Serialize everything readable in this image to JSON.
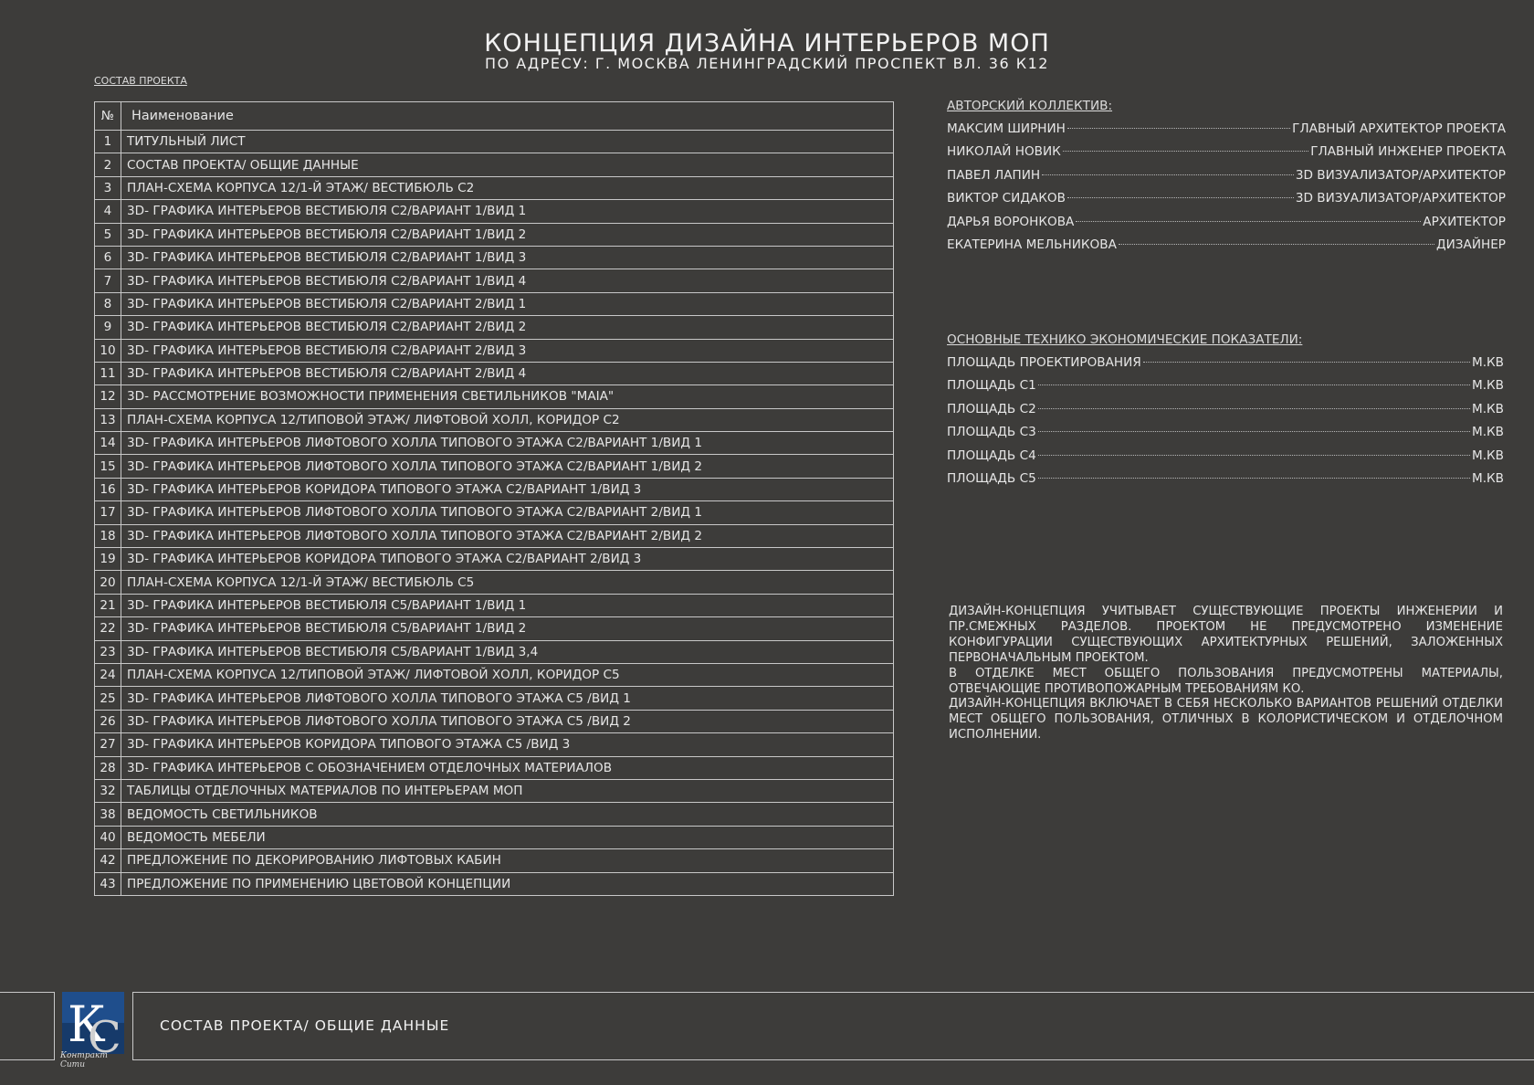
{
  "header": {
    "title": "КОНЦЕПЦИЯ ДИЗАЙНА ИНТЕРЬЕРОВ МОП",
    "subtitle": "ПО АДРЕСУ: Г. МОСКВА ЛЕНИНГРАДСКИЙ ПРОСПЕКТ ВЛ. 36 К12",
    "section_link": "СОСТАВ ПРОЕКТА"
  },
  "contents": {
    "col_num": "№",
    "col_name": "Наименование",
    "rows": [
      {
        "num": "1",
        "name": "ТИТУЛЬНЫЙ ЛИСТ"
      },
      {
        "num": "2",
        "name": "СОСТАВ ПРОЕКТА/ ОБЩИЕ ДАННЫЕ"
      },
      {
        "num": "3",
        "name": "ПЛАН-СХЕМА КОРПУСА 12/1-Й ЭТАЖ/ ВЕСТИБЮЛЬ С2"
      },
      {
        "num": "4",
        "name": "3D- ГРАФИКА ИНТЕРЬЕРОВ ВЕСТИБЮЛЯ С2/ВАРИАНТ 1/ВИД 1"
      },
      {
        "num": "5",
        "name": "3D- ГРАФИКА ИНТЕРЬЕРОВ ВЕСТИБЮЛЯ С2/ВАРИАНТ 1/ВИД 2"
      },
      {
        "num": "6",
        "name": "3D- ГРАФИКА ИНТЕРЬЕРОВ ВЕСТИБЮЛЯ С2/ВАРИАНТ 1/ВИД 3"
      },
      {
        "num": "7",
        "name": "3D- ГРАФИКА ИНТЕРЬЕРОВ ВЕСТИБЮЛЯ С2/ВАРИАНТ 1/ВИД 4"
      },
      {
        "num": "8",
        "name": "3D- ГРАФИКА ИНТЕРЬЕРОВ ВЕСТИБЮЛЯ С2/ВАРИАНТ 2/ВИД 1"
      },
      {
        "num": "9",
        "name": "3D- ГРАФИКА ИНТЕРЬЕРОВ ВЕСТИБЮЛЯ С2/ВАРИАНТ 2/ВИД 2"
      },
      {
        "num": "10",
        "name": "3D- ГРАФИКА ИНТЕРЬЕРОВ ВЕСТИБЮЛЯ С2/ВАРИАНТ 2/ВИД 3"
      },
      {
        "num": "11",
        "name": "3D- ГРАФИКА ИНТЕРЬЕРОВ ВЕСТИБЮЛЯ С2/ВАРИАНТ 2/ВИД 4"
      },
      {
        "num": "12",
        "name": "3D- РАССМОТРЕНИЕ ВОЗМОЖНОСТИ ПРИМЕНЕНИЯ СВЕТИЛЬНИКОВ \"MAIA\""
      },
      {
        "num": "13",
        "name": "ПЛАН-СХЕМА КОРПУСА 12/ТИПОВОЙ ЭТАЖ/ ЛИФТОВОЙ ХОЛЛ, КОРИДОР С2"
      },
      {
        "num": "14",
        "name": "3D- ГРАФИКА ИНТЕРЬЕРОВ ЛИФТОВОГО ХОЛЛА ТИПОВОГО ЭТАЖА С2/ВАРИАНТ 1/ВИД 1"
      },
      {
        "num": "15",
        "name": "3D- ГРАФИКА ИНТЕРЬЕРОВ ЛИФТОВОГО ХОЛЛА ТИПОВОГО ЭТАЖА С2/ВАРИАНТ 1/ВИД 2"
      },
      {
        "num": "16",
        "name": "3D- ГРАФИКА ИНТЕРЬЕРОВ КОРИДОРА ТИПОВОГО ЭТАЖА С2/ВАРИАНТ 1/ВИД 3"
      },
      {
        "num": "17",
        "name": "3D- ГРАФИКА ИНТЕРЬЕРОВ ЛИФТОВОГО ХОЛЛА ТИПОВОГО ЭТАЖА С2/ВАРИАНТ 2/ВИД 1"
      },
      {
        "num": "18",
        "name": "3D- ГРАФИКА ИНТЕРЬЕРОВ ЛИФТОВОГО ХОЛЛА ТИПОВОГО ЭТАЖА С2/ВАРИАНТ 2/ВИД 2"
      },
      {
        "num": "19",
        "name": "3D- ГРАФИКА ИНТЕРЬЕРОВ КОРИДОРА ТИПОВОГО ЭТАЖА С2/ВАРИАНТ 2/ВИД 3"
      },
      {
        "num": "20",
        "name": "ПЛАН-СХЕМА КОРПУСА 12/1-Й ЭТАЖ/ ВЕСТИБЮЛЬ С5"
      },
      {
        "num": "21",
        "name": "3D- ГРАФИКА ИНТЕРЬЕРОВ ВЕСТИБЮЛЯ С5/ВАРИАНТ 1/ВИД 1"
      },
      {
        "num": "22",
        "name": "3D- ГРАФИКА ИНТЕРЬЕРОВ ВЕСТИБЮЛЯ С5/ВАРИАНТ 1/ВИД 2"
      },
      {
        "num": "23",
        "name": "3D- ГРАФИКА ИНТЕРЬЕРОВ ВЕСТИБЮЛЯ С5/ВАРИАНТ 1/ВИД 3,4"
      },
      {
        "num": "24",
        "name": "ПЛАН-СХЕМА КОРПУСА 12/ТИПОВОЙ ЭТАЖ/ ЛИФТОВОЙ ХОЛЛ, КОРИДОР С5"
      },
      {
        "num": "25",
        "name": "3D- ГРАФИКА ИНТЕРЬЕРОВ ЛИФТОВОГО ХОЛЛА ТИПОВОГО ЭТАЖА С5 /ВИД 1"
      },
      {
        "num": "26",
        "name": "3D- ГРАФИКА ИНТЕРЬЕРОВ ЛИФТОВОГО ХОЛЛА ТИПОВОГО ЭТАЖА С5 /ВИД 2"
      },
      {
        "num": "27",
        "name": "3D- ГРАФИКА ИНТЕРЬЕРОВ КОРИДОРА ТИПОВОГО ЭТАЖА С5 /ВИД 3"
      },
      {
        "num": "28",
        "name": "3D- ГРАФИКА ИНТЕРЬЕРОВ С ОБОЗНАЧЕНИЕМ ОТДЕЛОЧНЫХ МАТЕРИАЛОВ"
      },
      {
        "num": "32",
        "name": "ТАБЛИЦЫ ОТДЕЛОЧНЫХ МАТЕРИАЛОВ ПО ИНТЕРЬЕРАМ МОП"
      },
      {
        "num": "38",
        "name": "ВЕДОМОСТЬ СВЕТИЛЬНИКОВ"
      },
      {
        "num": "40",
        "name": "ВЕДОМОСТЬ МЕБЕЛИ"
      },
      {
        "num": "42",
        "name": "ПРЕДЛОЖЕНИЕ ПО ДЕКОРИРОВАНИЮ ЛИФТОВЫХ КАБИН"
      },
      {
        "num": "43",
        "name": "ПРЕДЛОЖЕНИЕ ПО ПРИМЕНЕНИЮ ЦВЕТОВОЙ КОНЦЕПЦИИ"
      }
    ]
  },
  "authors": {
    "heading": "АВТОРСКИЙ КОЛЛЕКТИВ:",
    "rows": [
      {
        "name": "МАКСИМ ШИРНИН",
        "role": "ГЛАВНЫЙ АРХИТЕКТОР ПРОЕКТА"
      },
      {
        "name": "НИКОЛАЙ НОВИК",
        "role": "ГЛАВНЫЙ ИНЖЕНЕР ПРОЕКТА"
      },
      {
        "name": "ПАВЕЛ ЛАПИН",
        "role": "3D ВИЗУАЛИЗАТОР/АРХИТЕКТОР"
      },
      {
        "name": "ВИКТОР СИДАКОВ",
        "role": "3D ВИЗУАЛИЗАТОР/АРХИТЕКТОР"
      },
      {
        "name": "ДАРЬЯ ВОРОНКОВА",
        "role": "АРХИТЕКТОР"
      },
      {
        "name": "ЕКАТЕРИНА МЕЛЬНИКОВА",
        "role": "ДИЗАЙНЕР"
      }
    ]
  },
  "indicators": {
    "heading": "ОСНОВНЫЕ ТЕХНИКО ЭКОНОМИЧЕСКИЕ ПОКАЗАТЕЛИ:",
    "rows": [
      {
        "label": "ПЛОЩАДЬ ПРОЕКТИРОВАНИЯ",
        "unit": "М.КВ"
      },
      {
        "label": "ПЛОЩАДЬ С1",
        "unit": "М.КВ"
      },
      {
        "label": "ПЛОЩАДЬ С2",
        "unit": "М.КВ"
      },
      {
        "label": "ПЛОЩАДЬ С3",
        "unit": "М.КВ"
      },
      {
        "label": "ПЛОЩАДЬ С4",
        "unit": "М.КВ"
      },
      {
        "label": "ПЛОЩАДЬ С5",
        "unit": "М.КВ"
      }
    ]
  },
  "description": [
    "ДИЗАЙН-КОНЦЕПЦИЯ УЧИТЫВАЕТ СУЩЕСТВУЮЩИЕ ПРОЕКТЫ ИНЖЕНЕРИИ И ПР.СМЕЖНЫХ РАЗДЕЛОВ. ПРОЕКТОМ НЕ ПРЕДУСМОТРЕНО ИЗМЕНЕНИЕ КОНФИГУРАЦИИ СУЩЕСТВУЮЩИХ АРХИТЕКТУРНЫХ РЕШЕНИЙ, ЗАЛОЖЕННЫХ ПЕРВОНАЧАЛЬНЫМ ПРОЕКТОМ.",
    "В ОТДЕЛКЕ МЕСТ ОБЩЕГО ПОЛЬЗОВАНИЯ ПРЕДУСМОТРЕНЫ МАТЕРИАЛЫ, ОТВЕЧАЮЩИЕ ПРОТИВОПОЖАРНЫМ ТРЕБОВАНИЯМ КО.",
    "ДИЗАЙН-КОНЦЕПЦИЯ ВКЛЮЧАЕТ В СЕБЯ НЕСКОЛЬКО ВАРИАНТОВ РЕШЕНИЙ ОТДЕЛКИ МЕСТ ОБЩЕГО ПОЛЬЗОВАНИЯ, ОТЛИЧНЫХ В КОЛОРИСТИЧЕСКОМ И ОТДЕЛОЧНОМ ИСПОЛНЕНИИ."
  ],
  "footer": {
    "sheet_title": "СОСТАВ ПРОЕКТА/ ОБЩИЕ ДАННЫЕ",
    "logo_caption": "Контракт Сити",
    "logo_letters": "КС"
  },
  "colors": {
    "background": "#3d3c3a",
    "text": "#e6e6e6",
    "lines": "#c8c8c8",
    "logo_blue": "#1f4e8c"
  }
}
